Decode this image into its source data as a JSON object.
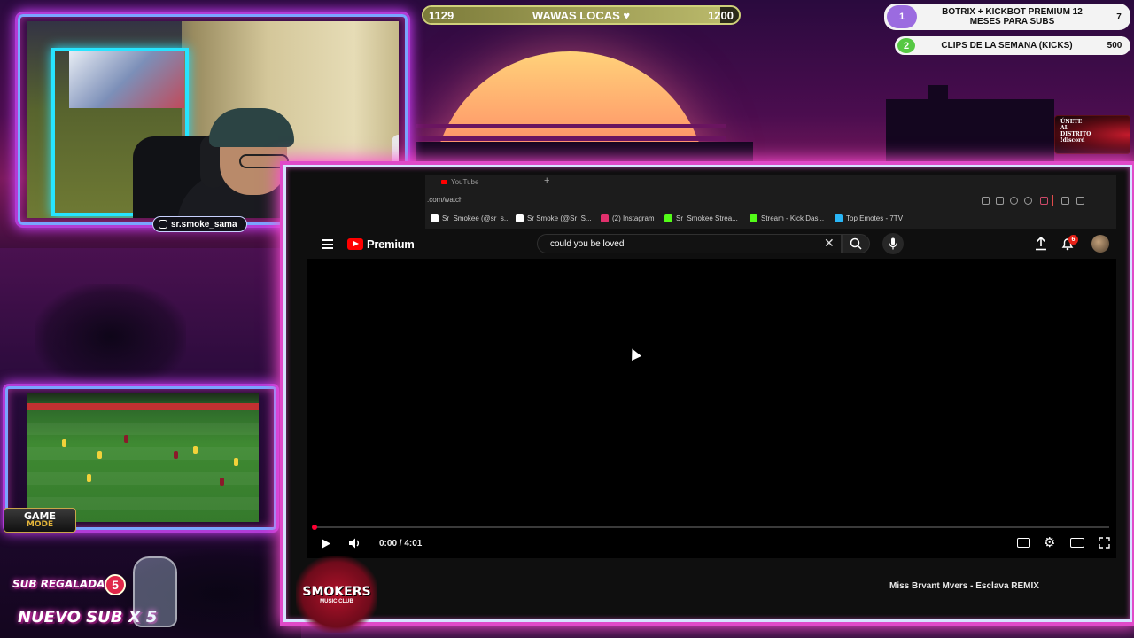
{
  "progress_bar": {
    "left_value": "1129",
    "title": "WAWAS LOCAS ♥",
    "right_value": "1200",
    "fill_fraction": 0.94
  },
  "goals": [
    {
      "number": "1",
      "title_line1": "BOTRIX + KICKBOT PREMIUM 12",
      "title_line2": "MESES PARA SUBS",
      "value": "7"
    },
    {
      "number": "2",
      "title": "CLIPS DE LA SEMANA (KICKS)",
      "value": "500"
    }
  ],
  "webcam": {
    "instagram_handle": "sr.smoke_sama"
  },
  "discord_badge": {
    "line1": "ÚNETE",
    "line2": "AL",
    "line3": "DISTRITO",
    "line4": "!discord"
  },
  "game_mode_badge": {
    "line1": "GAME",
    "line2": "MODE"
  },
  "promos": {
    "sub_gift_label": "SUB REGALADA X",
    "sub_gift_count": "5",
    "new_sub_label": "NUEVO SUB X 5"
  },
  "smokers_logo": {
    "main": "SMOKERS",
    "sub": "MUSIC CLUB"
  },
  "browser": {
    "tab_title": "YouTube",
    "url": ".com/watch",
    "bookmarks": [
      {
        "label": "Sr_Smokee (@sr_s...",
        "icon": "tiktok-icon",
        "color": "#ffffff"
      },
      {
        "label": "Sr Smoke (@Sr_S...",
        "icon": "x-icon",
        "color": "#ffffff"
      },
      {
        "label": "(2) Instagram",
        "icon": "instagram-icon",
        "color": "#e1306c"
      },
      {
        "label": "Sr_Smokee Strea...",
        "icon": "kick-icon",
        "color": "#53fc18"
      },
      {
        "label": "Stream - Kick Das...",
        "icon": "kick-icon",
        "color": "#53fc18"
      },
      {
        "label": "Top Emotes - 7TV",
        "icon": "7tv-icon",
        "color": "#29b6f6"
      }
    ]
  },
  "youtube": {
    "logo_text": "Premium",
    "search_query": "could you be loved",
    "notification_count": "6",
    "time_display": "0:00 / 4:01",
    "progress_fraction": 0.0,
    "next_video_title": "Miss Bryant Myers - Esclava REMIX"
  }
}
